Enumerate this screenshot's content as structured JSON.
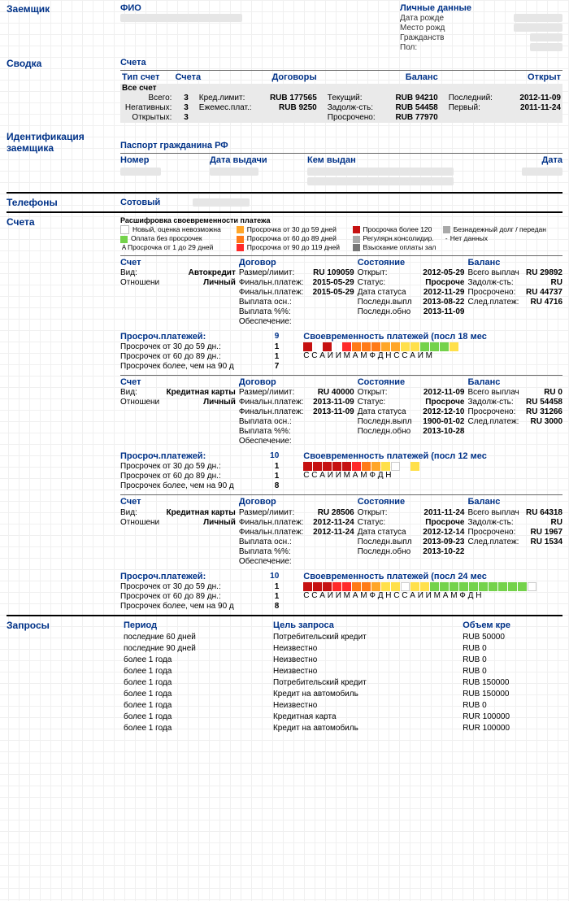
{
  "borrower": {
    "section": "Заемщик",
    "fio_label": "ФИО",
    "personal_label": "Личные данные",
    "dob_label": "Дата рожде",
    "pob_label": "Место рожд",
    "citizenship_label": "Гражданств",
    "gender_label": "Пол:"
  },
  "summary": {
    "section": "Сводка",
    "accounts_label": "Счета",
    "type_col": "Тип счет",
    "cnt_col": "Счета",
    "contracts_col": "Договоры",
    "balance_col": "Баланс",
    "open_col": "Открыт",
    "rows_left_labels": [
      "Всего:",
      "Негативных:",
      "Открытых:"
    ],
    "rows_left_vals": [
      "3",
      "3",
      "3"
    ],
    "all_accounts_label": "Все счет",
    "credit_limit_label": "Кред.лимит:",
    "credit_limit_val": "RUB  177565",
    "monthly_pay_label": "Ежемес.плат.:",
    "monthly_pay_val": "RUB  9250",
    "current_label": "Текущий:",
    "current_val": "RUB  94210",
    "debt_label": "Задолж-сть:",
    "debt_val": "RUB  54458",
    "overdue_label": "Просрочено:",
    "overdue_val": "RUB  77970",
    "last_label": "Последний:",
    "last_val": "2012-11-09",
    "first_label": "Первый:",
    "first_val": "2011-11-24"
  },
  "identification": {
    "section": "Идентификация заемщика",
    "doc_label": "Паспорт гражданина РФ",
    "num_col": "Номер",
    "date_col": "Дата выдачи",
    "issued_col": "Кем выдан",
    "date2_col": "Дата"
  },
  "phones": {
    "section": "Телефоны",
    "mobile_label": "Сотовый"
  },
  "accounts": {
    "section": "Счета",
    "legend_title": "Расшифровка своевременности платежа",
    "legend": [
      {
        "cls": "sw-white",
        "txt": "Новый, оценка невозможна"
      },
      {
        "cls": "sw-green",
        "txt": "Оплата без просрочек"
      },
      {
        "cls": "sw-yellow",
        "txt": "Просрочка от 1 до 29 дней",
        "pref": "А"
      },
      {
        "cls": "sw-orange",
        "txt": "Просрочка от 30 до 59 дней"
      },
      {
        "cls": "sw-dorange",
        "txt": "Просрочка от 60 до 89 дней"
      },
      {
        "cls": "sw-red",
        "txt": "Просрочка от 90 до 119 дней"
      },
      {
        "cls": "sw-dred",
        "txt": "Просрочка более 120"
      },
      {
        "cls": "sw-gray",
        "txt": "Безнадежный долг / передан"
      },
      {
        "cls": "sw-gray",
        "txt": "Регулярн.консолидир."
      },
      {
        "cls": "sw-dgray",
        "txt": "Взыскание оплаты зал"
      },
      {
        "cls": "sw-white",
        "txt": "Нет данных",
        "pref": "-"
      }
    ],
    "col_headers": {
      "acct": "Счет",
      "contract": "Договор",
      "state": "Состояние",
      "balance": "Баланс"
    },
    "kv_labels": {
      "type": "Вид:",
      "relation": "Отношени",
      "limit": "Размер/лимит:",
      "final": "Финальн.платеж:",
      "pay_main": "Выплата осн.:",
      "pay_pct": "Выплата %%:",
      "collateral": "Обеспечение:",
      "open": "Открыт:",
      "status": "Статус:",
      "status_date": "Дата статуса",
      "last_pay": "Последн.выпл",
      "last_upd": "Последн.обно",
      "total_paid": "Всего выплач",
      "debt": "Задолж-сть:",
      "overdue": "Просрочено:",
      "next": "След.платеж:"
    },
    "late_labels": {
      "header": "Просроч.платежей:",
      "l1": "Просрочек от 30 до 59 дн.:",
      "l2": "Просрочек от 60 до 89 дн.:",
      "l3": "Просрочек более, чем на 90 д",
      "timeliness": "Своевременность платежей (посл"
    },
    "list": [
      {
        "type": "Автокредит",
        "relation": "Личный",
        "limit": "RU 109059",
        "final1": "2015-05-29",
        "final2": "2015-05-29",
        "open": "2012-05-29",
        "status": "Просроче",
        "status_date": "2012-11-29",
        "last_pay": "2013-08-22",
        "last_upd": "2013-11-09",
        "total_paid": "RU 29892",
        "debt": "RU",
        "overdue": "RU 44737",
        "next": "RU 4716",
        "late_total": "9",
        "late1": "1",
        "late2": "1",
        "late3": "7",
        "months": "18",
        "colors": [
          "cE",
          "cn",
          "cE",
          "cn",
          "cD",
          "cC",
          "cC",
          "cC",
          "cB",
          "cB",
          "cA",
          "cA",
          "c1",
          "c1",
          "c1",
          "cA",
          "cn"
        ],
        "letters": "С С А И И М А М Ф  Д Н С С А И М"
      },
      {
        "type": "Кредитная карты",
        "relation": "Личный",
        "limit": "RU 40000",
        "final1": "2013-11-09",
        "final2": "2013-11-09",
        "open": "2012-11-09",
        "status": "Просроче",
        "status_date": "2012-12-10",
        "last_pay": "1900-01-02",
        "last_upd": "2013-10-28",
        "total_paid": "RU 0",
        "debt": "RU 54458",
        "overdue": "RU 31266",
        "next": "RU 3000",
        "late_total": "10",
        "late1": "1",
        "late2": "1",
        "late3": "8",
        "months": "12",
        "colors": [
          "cE",
          "cE",
          "cE",
          "cE",
          "cE",
          "cD",
          "cC",
          "cB",
          "cA",
          "c0",
          "cn",
          "cA"
        ],
        "letters": "С С А И И М А М Ф   Д Н"
      },
      {
        "type": "Кредитная карты",
        "relation": "Личный",
        "limit": "RU 28506",
        "final1": "2012-11-24",
        "final2": "2012-11-24",
        "open": "2011-11-24",
        "status": "Просроче",
        "status_date": "2012-12-14",
        "last_pay": "2013-09-23",
        "last_upd": "2013-10-22",
        "total_paid": "RU 64318",
        "debt": "RU",
        "overdue": "RU 1967",
        "next": "RU 1534",
        "late_total": "10",
        "late1": "1",
        "late2": "1",
        "late3": "8",
        "months": "24",
        "colors": [
          "cE",
          "cE",
          "cE",
          "cD",
          "cD",
          "cC",
          "cC",
          "cB",
          "cA",
          "cA",
          "c0",
          "cA",
          "cA",
          "c1",
          "c1",
          "c1",
          "c1",
          "c1",
          "c1",
          "c1",
          "c1",
          "c1",
          "c1",
          "c0"
        ],
        "letters": "С С А И И М А М Ф  Д Н С С А И И М А М Ф  Д Н"
      }
    ]
  },
  "inquiries": {
    "section": "Запросы",
    "cols": {
      "period": "Период",
      "purpose": "Цель запроса",
      "amount": "Объем кре"
    },
    "rows": [
      {
        "p": "последние 60 дней",
        "g": "Потребительский кредит",
        "a": "RUB 50000"
      },
      {
        "p": "последние 90 дней",
        "g": "Неизвестно",
        "a": "RUB 0"
      },
      {
        "p": "более 1 года",
        "g": "Неизвестно",
        "a": "RUB 0"
      },
      {
        "p": "более 1 года",
        "g": "Неизвестно",
        "a": "RUB 0"
      },
      {
        "p": "более 1 года",
        "g": "Потребительский кредит",
        "a": "RUB 150000"
      },
      {
        "p": "более 1 года",
        "g": "Кредит на автомобиль",
        "a": "RUB 150000"
      },
      {
        "p": "более 1 года",
        "g": "Неизвестно",
        "a": "RUB 0"
      },
      {
        "p": "более 1 года",
        "g": "Кредитная карта",
        "a": "RUR 100000"
      },
      {
        "p": "более 1 года",
        "g": "Кредит на автомобиль",
        "a": "RUR 100000"
      }
    ]
  }
}
